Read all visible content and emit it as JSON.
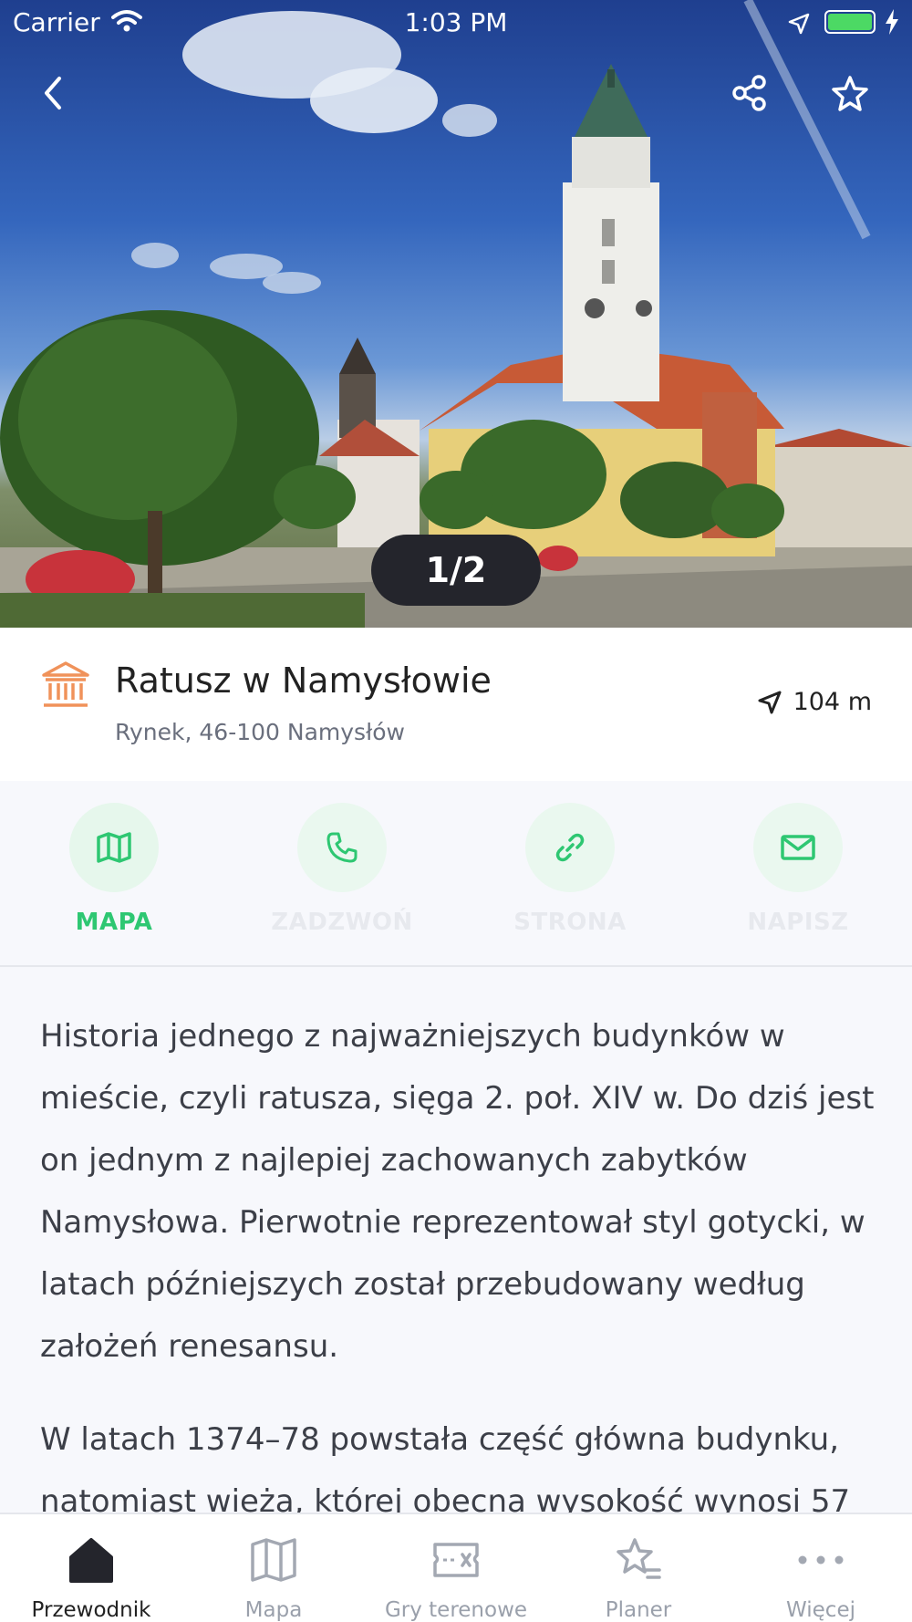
{
  "status_bar": {
    "carrier": "Carrier",
    "time": "1:03 PM"
  },
  "gallery": {
    "counter": "1/2"
  },
  "place": {
    "title": "Ratusz w Namysłowie",
    "address": "Rynek, 46-100 Namysłów",
    "distance": "104 m",
    "category_icon": "museum-icon"
  },
  "actions": [
    {
      "label": "MAPA",
      "icon": "map-icon",
      "state": "active"
    },
    {
      "label": "ZADZWOŃ",
      "icon": "phone-icon",
      "state": "disabled"
    },
    {
      "label": "STRONA",
      "icon": "link-icon",
      "state": "disabled"
    },
    {
      "label": "NAPISZ",
      "icon": "mail-icon",
      "state": "disabled"
    }
  ],
  "description": {
    "paragraphs": [
      "Historia jednego z najważniejszych budynków w mieście, czyli ratusza, sięga 2. poł. XIV w. Do dziś jest on jednym z najlepiej zachowanych zabytków Namysłowa. Pierwotnie reprezentował styl gotycki, w latach późniejszych został przebudowany według założeń renesansu.",
      "W latach 1374–78 powstała część główna budynku, natomiast wieża, której obecna wysokość wynosi 57"
    ]
  },
  "tabs": [
    {
      "label": "Przewodnik",
      "icon": "home-icon",
      "active": true
    },
    {
      "label": "Mapa",
      "icon": "map-icon",
      "active": false
    },
    {
      "label": "Gry terenowe",
      "icon": "ticket-icon",
      "active": false
    },
    {
      "label": "Planer",
      "icon": "star-list-icon",
      "active": false
    },
    {
      "label": "Więcej",
      "icon": "more-icon",
      "active": false
    }
  ],
  "colors": {
    "accent": "#2ec772",
    "category": "#f0925a",
    "dark": "#24252c"
  }
}
